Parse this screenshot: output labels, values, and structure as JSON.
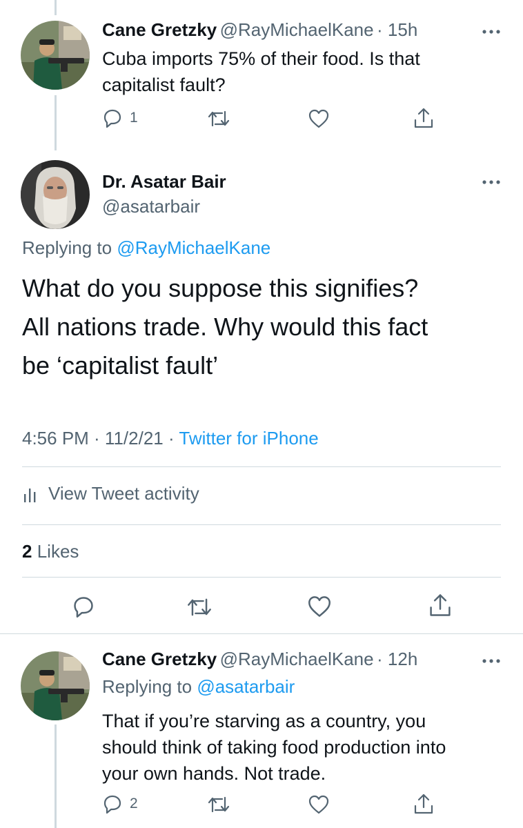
{
  "tweet1": {
    "name": "Cane Gretzky",
    "handle": "@RayMichaelKane",
    "time": "· 15h",
    "text_line1": "Cuba imports 75% of their food. Is that",
    "text_line2": "capitalist fault?",
    "reply_count": "1"
  },
  "main": {
    "name": "Dr. Asatar Bair",
    "handle": "@asatarbair",
    "replying_prefix": "Replying to ",
    "replying_handle": "@RayMichaelKane",
    "text_line1": "What do you suppose this signifies?",
    "text_line2": "All nations trade. Why would this fact",
    "text_line3": "be ‘capitalist fault’",
    "time": "4:56 PM · 11/2/21 · ",
    "source": "Twitter for iPhone",
    "activity_label": "View Tweet activity",
    "likes_count": "2",
    "likes_label": "Likes"
  },
  "tweet3": {
    "name": "Cane Gretzky",
    "handle": "@RayMichaelKane",
    "time": "· 12h",
    "replying_prefix": "Replying to ",
    "replying_handle": "@asatarbair",
    "text_line1": "That if you’re starving as a country, you",
    "text_line2": "should think of taking food production into",
    "text_line3": "your own hands. Not trade.",
    "reply_count": "2"
  },
  "colors": {
    "link": "#1d9bf0",
    "secondary_text": "#536471",
    "divider": "#cfd9de"
  },
  "icons": [
    "reply-icon",
    "retweet-icon",
    "like-icon",
    "share-icon",
    "more-icon",
    "activity-icon"
  ]
}
